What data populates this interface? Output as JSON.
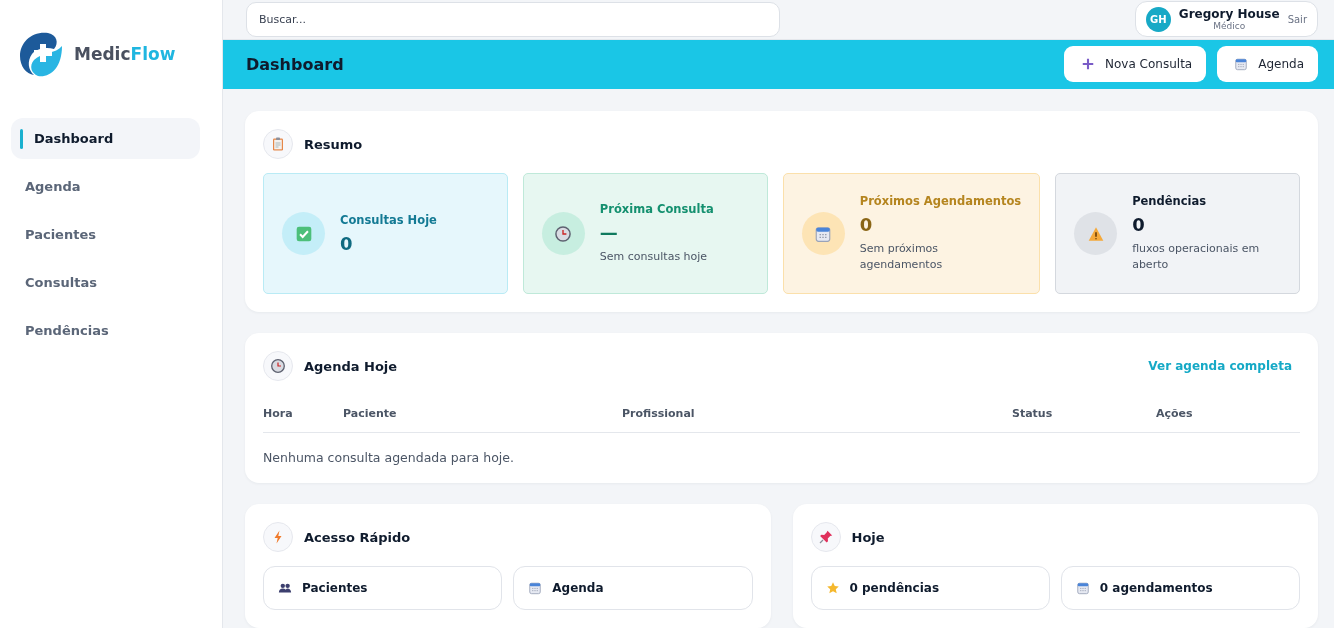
{
  "sidebar": {
    "logo": {
      "part_1": "Medic",
      "part_2": "Flow"
    },
    "items": [
      {
        "label": "Dashboard",
        "selected": true
      },
      {
        "label": "Agenda",
        "selected": false
      },
      {
        "label": "Pacientes",
        "selected": false
      },
      {
        "label": "Consultas",
        "selected": false
      },
      {
        "label": "Pendências",
        "selected": false
      }
    ]
  },
  "topbar": {
    "search": {
      "placeholder": "Buscar..."
    },
    "user": {
      "initials": "GH",
      "name": "Gregory House",
      "role": "Médico",
      "logout": "Sair"
    }
  },
  "header": {
    "title": "Dashboard",
    "buttons": [
      {
        "kind": "plus",
        "label": "Nova Consulta"
      },
      {
        "kind": "calendar",
        "label": "Agenda"
      }
    ]
  },
  "summary": {
    "title": "Resumo",
    "cards": [
      {
        "kind": "info",
        "title": "Consultas Hoje",
        "value": "0"
      },
      {
        "kind": "success",
        "title": "Próxima Consulta",
        "value": "—",
        "note": "Sem consultas hoje"
      },
      {
        "kind": "warning",
        "title": "Próximos Agendamentos",
        "value": "0",
        "note": "Sem próximos agendamentos"
      },
      {
        "kind": "neutral",
        "title": "Pendências",
        "value": "0",
        "note": "fluxos operacionais em aberto"
      }
    ]
  },
  "agenda": {
    "title": "Agenda Hoje",
    "link": "Ver agenda completa",
    "table": {
      "columns": [
        "Hora",
        "Paciente",
        "Profissional",
        "Status",
        "Ações"
      ],
      "empty": "Nenhuma consulta agendada para hoje."
    }
  },
  "quick_access": {
    "title": "Acesso Rápido",
    "items": [
      {
        "kind": "people",
        "label": "Pacientes"
      },
      {
        "kind": "calendar",
        "label": "Agenda"
      }
    ]
  },
  "today": {
    "title": "Hoje",
    "items": [
      {
        "kind": "star",
        "label": "0 pendências"
      },
      {
        "kind": "calendar",
        "label": "0 agendamentos"
      }
    ]
  }
}
